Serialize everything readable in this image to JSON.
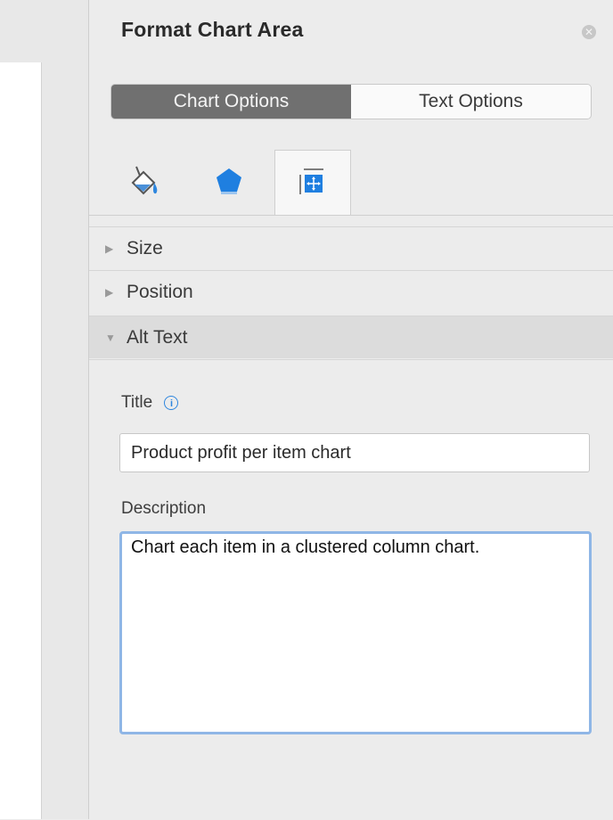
{
  "pane": {
    "title": "Format Chart Area",
    "close_icon": "close-icon"
  },
  "segmented": {
    "chart_options": "Chart Options",
    "text_options": "Text Options"
  },
  "icon_tabs": [
    {
      "name": "fill-line-icon",
      "selected": false
    },
    {
      "name": "effects-pentagon-icon",
      "selected": false
    },
    {
      "name": "size-properties-icon",
      "selected": true
    }
  ],
  "sections": {
    "size": "Size",
    "position": "Position",
    "alt_text": "Alt Text"
  },
  "alt_text": {
    "title_label": "Title",
    "title_value": "Product profit per item chart",
    "description_label": "Description",
    "description_value": "Chart each item in a clustered column chart."
  },
  "colors": {
    "accent": "#2e86de",
    "focus_ring": "#8fb6e6",
    "segment_active": "#707070"
  }
}
